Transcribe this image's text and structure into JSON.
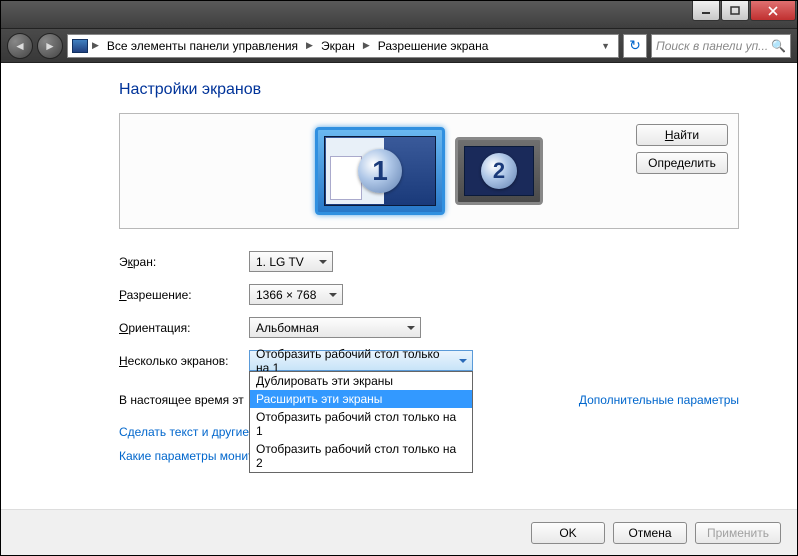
{
  "breadcrumbs": {
    "root": "Все элементы панели управления",
    "mid": "Экран",
    "leaf": "Разрешение экрана"
  },
  "search_placeholder": "Поиск в панели уп...",
  "page_title": "Настройки экранов",
  "buttons": {
    "find": "Найти",
    "detect": "Определить",
    "ok": "OK",
    "cancel": "Отмена",
    "apply": "Применить"
  },
  "monitors": {
    "m1": "1",
    "m2": "2"
  },
  "labels": {
    "screen_pre": "Э",
    "screen_ul": "к",
    "screen_post": "ран:",
    "res_pre": "",
    "res_ul": "Р",
    "res_post": "азрешение:",
    "orient_pre": "",
    "orient_ul": "О",
    "orient_post": "риентация:",
    "multi_pre": "",
    "multi_ul": "Н",
    "multi_post": "есколько экранов:"
  },
  "values": {
    "screen": "1. LG TV",
    "resolution": "1366 × 768",
    "orientation": "Альбомная",
    "multi": "Отобразить рабочий стол только на 1"
  },
  "dropdown_options": [
    "Дублировать эти экраны",
    "Расширить эти экраны",
    "Отобразить рабочий стол только на 1",
    "Отобразить рабочий стол только на 2"
  ],
  "dropdown_highlighted_index": 1,
  "main_monitor_text": "В настоящее время эт",
  "advanced_params": "Дополнительные параметры",
  "link_textsize": "Сделать текст и другие элементы больше или меньше",
  "link_whichmon": "Какие параметры монитора следует выбрать?"
}
